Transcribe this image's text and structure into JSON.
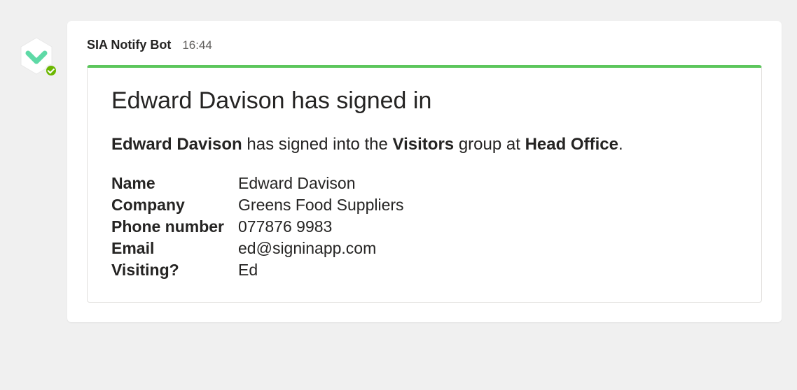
{
  "header": {
    "bot_name": "SIA Notify Bot",
    "timestamp": "16:44"
  },
  "card": {
    "accent_color": "#5cc65c",
    "title": "Edward Davison has signed in",
    "summary": {
      "person": "Edward Davison",
      "text_1": " has signed into the ",
      "group": "Visitors",
      "text_2": " group at ",
      "site": "Head Office",
      "text_3": "."
    },
    "fields": [
      {
        "label": "Name",
        "value": "Edward Davison"
      },
      {
        "label": "Company",
        "value": "Greens Food Suppliers"
      },
      {
        "label": "Phone number",
        "value": "077876 9983"
      },
      {
        "label": "Email",
        "value": "ed@signinapp.com"
      },
      {
        "label": "Visiting?",
        "value": "Ed"
      }
    ]
  }
}
